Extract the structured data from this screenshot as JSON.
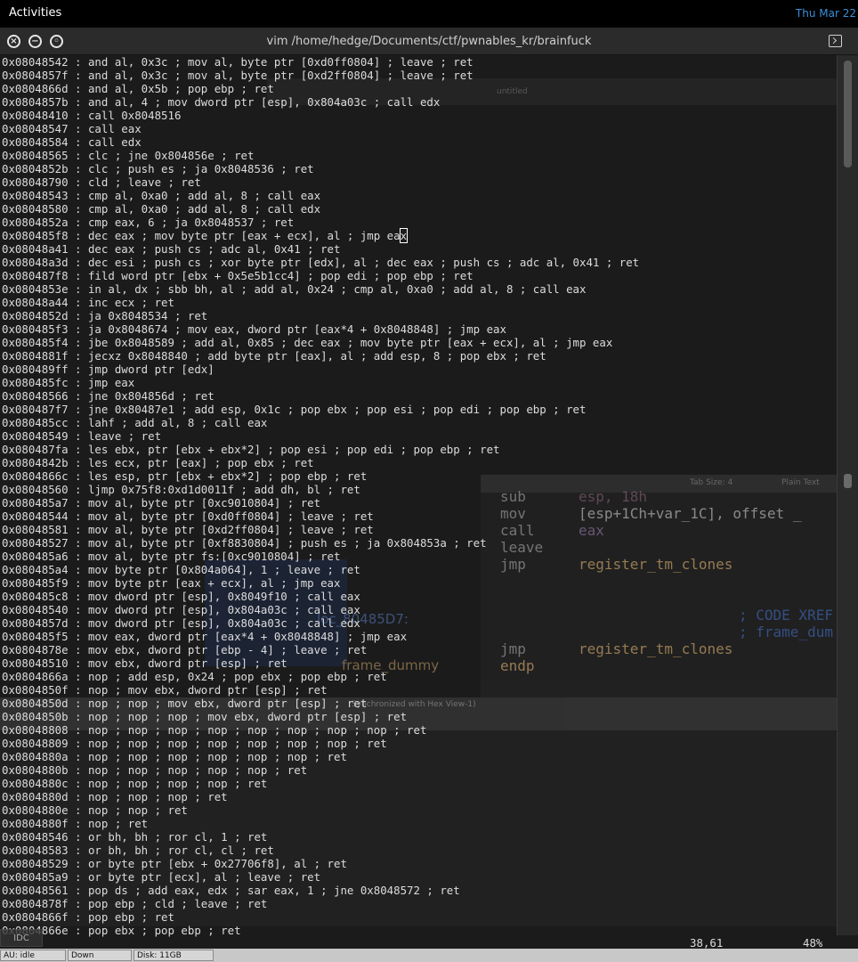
{
  "topbar": {
    "activities_label": "Activities",
    "clock": "Thu Mar 22"
  },
  "window": {
    "title": "vim  /home/hedge/Documents/ctf/pwnables_kr/brainfuck"
  },
  "vim_lines": [
    "0x08048542 : and al, 0x3c ; mov al, byte ptr [0xd0ff0804] ; leave ; ret",
    "0x0804857f : and al, 0x3c ; mov al, byte ptr [0xd2ff0804] ; leave ; ret",
    "0x0804866d : and al, 0x5b ; pop ebp ; ret",
    "0x0804857b : and al, 4 ; mov dword ptr [esp], 0x804a03c ; call edx",
    "0x08048410 : call 0x8048516",
    "0x08048547 : call eax",
    "0x08048584 : call edx",
    "0x08048565 : clc ; jne 0x804856e ; ret",
    "0x0804852b : clc ; push es ; ja 0x8048536 ; ret",
    "0x08048790 : cld ; leave ; ret",
    "0x08048543 : cmp al, 0xa0 ; add al, 8 ; call eax",
    "0x08048580 : cmp al, 0xa0 ; add al, 8 ; call edx",
    "0x0804852a : cmp eax, 6 ; ja 0x8048537 ; ret",
    "0x080485f8 : dec eax ; mov byte ptr [eax + ecx], al ; jmp eax",
    "0x08048a41 : dec eax ; push cs ; adc al, 0x41 ; ret",
    "0x08048a3d : dec esi ; push cs ; xor byte ptr [edx], al ; dec eax ; push cs ; adc al, 0x41 ; ret",
    "0x080487f8 : fild word ptr [ebx + 0x5e5b1cc4] ; pop edi ; pop ebp ; ret",
    "0x0804853e : in al, dx ; sbb bh, al ; add al, 0x24 ; cmp al, 0xa0 ; add al, 8 ; call eax",
    "0x08048a44 : inc ecx ; ret",
    "0x0804852d : ja 0x8048534 ; ret",
    "0x080485f3 : ja 0x8048674 ; mov eax, dword ptr [eax*4 + 0x8048848] ; jmp eax",
    "0x080485f4 : jbe 0x8048589 ; add al, 0x85 ; dec eax ; mov byte ptr [eax + ecx], al ; jmp eax",
    "0x0804881f : jecxz 0x8048840 ; add byte ptr [eax], al ; add esp, 8 ; pop ebx ; ret",
    "0x080489ff : jmp dword ptr [edx]",
    "0x080485fc : jmp eax",
    "0x08048566 : jne 0x804856d ; ret",
    "0x080487f7 : jne 0x80487e1 ; add esp, 0x1c ; pop ebx ; pop esi ; pop edi ; pop ebp ; ret",
    "0x080485cc : lahf ; add al, 8 ; call eax",
    "0x08048549 : leave ; ret",
    "0x080487fa : les ebx, ptr [ebx + ebx*2] ; pop esi ; pop edi ; pop ebp ; ret",
    "0x0804842b : les ecx, ptr [eax] ; pop ebx ; ret",
    "0x0804866c : les esp, ptr [ebx + ebx*2] ; pop ebp ; ret",
    "0x08048560 : ljmp 0x75f8:0xd1d0011f ; add dh, bl ; ret",
    "0x080485a7 : mov al, byte ptr [0xc9010804] ; ret",
    "0x08048544 : mov al, byte ptr [0xd0ff0804] ; leave ; ret",
    "0x08048581 : mov al, byte ptr [0xd2ff0804] ; leave ; ret",
    "0x08048527 : mov al, byte ptr [0xf8830804] ; push es ; ja 0x804853a ; ret",
    "0x080485a6 : mov al, byte ptr fs:[0xc9010804] ; ret",
    "0x080485a4 : mov byte ptr [0x804a064], 1 ; leave ; ret",
    "0x080485f9 : mov byte ptr [eax + ecx], al ; jmp eax",
    "0x080485c8 : mov dword ptr [esp], 0x8049f10 ; call eax",
    "0x08048540 : mov dword ptr [esp], 0x804a03c ; call eax",
    "0x0804857d : mov dword ptr [esp], 0x804a03c ; call edx",
    "0x080485f5 : mov eax, dword ptr [eax*4 + 0x8048848] ; jmp eax",
    "0x0804878e : mov ebx, dword ptr [ebp - 4] ; leave ; ret",
    "0x08048510 : mov ebx, dword ptr [esp] ; ret",
    "0x0804866a : nop ; add esp, 0x24 ; pop ebx ; pop ebp ; ret",
    "0x0804850f : nop ; mov ebx, dword ptr [esp] ; ret",
    "0x0804850d : nop ; nop ; mov ebx, dword ptr [esp] ; ret",
    "0x0804850b : nop ; nop ; nop ; mov ebx, dword ptr [esp] ; ret",
    "0x08048808 : nop ; nop ; nop ; nop ; nop ; nop ; nop ; nop ; ret",
    "0x08048809 : nop ; nop ; nop ; nop ; nop ; nop ; nop ; ret",
    "0x0804880a : nop ; nop ; nop ; nop ; nop ; nop ; ret",
    "0x0804880b : nop ; nop ; nop ; nop ; nop ; ret",
    "0x0804880c : nop ; nop ; nop ; nop ; ret",
    "0x0804880d : nop ; nop ; nop ; ret",
    "0x0804880e : nop ; nop ; ret",
    "0x0804880f : nop ; ret",
    "0x08048546 : or bh, bh ; ror cl, 1 ; ret",
    "0x08048583 : or bh, bh ; ror cl, cl ; ret",
    "0x08048529 : or byte ptr [ebx + 0x27706f8], al ; ret",
    "0x080485a9 : or byte ptr [ecx], al ; leave ; ret",
    "0x08048561 : pop ds ; add eax, edx ; sar eax, 1 ; jne 0x8048572 ; ret",
    "0x0804878f : pop ebp ; cld ; leave ; ret",
    "0x0804866f : pop ebp ; ret",
    "0x0804866e : pop ebx ; pop ebp ; ret"
  ],
  "cursor": {
    "line_index": 13,
    "column": 61
  },
  "ruler": {
    "position": "38,61",
    "percent": "48%"
  },
  "background_ghosts": {
    "tab_untitled": "untitled",
    "tab_size": "Tab Size: 4",
    "syntax": "Plain Text",
    "ida_mnemonics": [
      "sub",
      "mov",
      "call",
      "leave",
      "jmp",
      "jmp",
      "endp"
    ],
    "ida_operands": [
      "esp, 18h",
      "[esp+1Ch+var_1C], offset _",
      "eax",
      "register_tm_clones",
      "register_tm_clones"
    ],
    "ida_loc": "loc_80485D7:",
    "ida_xref": "; CODE XREF",
    "ida_frame": "; frame_dum",
    "ida_endp": "frame_dummy",
    "sync_note": "Synchronized with Hex View-1)",
    "ide_tab": "IDC"
  },
  "taskbar": {
    "au": "AU: idle",
    "down": "Down",
    "disk": "Disk: 11GB"
  }
}
